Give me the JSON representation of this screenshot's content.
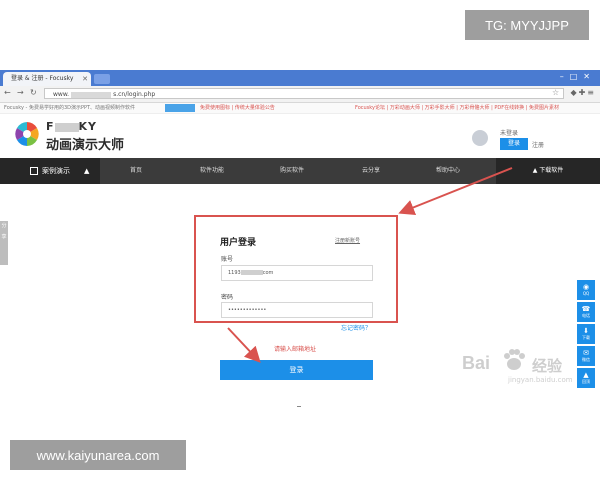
{
  "watermarks": {
    "top": "TG: MYYJJPP",
    "bottom": "www.kaiyunarea.com"
  },
  "browser": {
    "tab_title": "登录 & 注册 - Focusky",
    "url_prefix": "www.",
    "url_suffix": "s.cn/login.php",
    "notice_left": "Focusky - 免费易学好用的3D演示PPT、动画视频制作软件",
    "notice_red": "免费使用图标 | 传统大量体验公告",
    "notice_right": "Focusky论坛 | 万彩动画大师 | 万彩手影大师 | 万彩骨骼大师 | PDF在线转换 | 免费图片素材"
  },
  "header": {
    "logo_prefix": "F",
    "logo_suffix": "KY",
    "logo_text": "动画演示大师",
    "user_name": "未登录",
    "login_label": "登录",
    "register_label": "注册"
  },
  "nav": {
    "first": "案例演示",
    "items": [
      "首页",
      "软件功能",
      "购买软件",
      "云分享",
      "帮助中心"
    ],
    "download": "下载软件"
  },
  "page_tab": "分享",
  "login_form": {
    "title": "用户登录",
    "register_link": "注册新账号",
    "account_label": "账号",
    "account_prefix": "1193",
    "account_suffix": "com",
    "password_label": "密码",
    "password_value": "•••••••••••••",
    "forgot": "忘记密码？",
    "error": "请输入邮箱地址",
    "submit": "登录"
  },
  "side_float": [
    {
      "icon": "qq-icon",
      "glyph": "◉",
      "label": "QQ"
    },
    {
      "icon": "phone-icon",
      "glyph": "☎",
      "label": "电话"
    },
    {
      "icon": "download-icon",
      "glyph": "⬇",
      "label": "下载"
    },
    {
      "icon": "wechat-icon",
      "glyph": "✉",
      "label": "微信"
    },
    {
      "icon": "back-to-top-icon",
      "glyph": "▲",
      "label": "回顶"
    }
  ],
  "baidu_watermark": {
    "brand": "Bai",
    "brand_cn": "经验",
    "sub": "jingyan.baidu.com"
  },
  "colors": {
    "accent": "#1c8fe8",
    "highlight": "#d9534f",
    "navbar": "#3b3b3b",
    "tabbar": "#4a7bd1"
  }
}
